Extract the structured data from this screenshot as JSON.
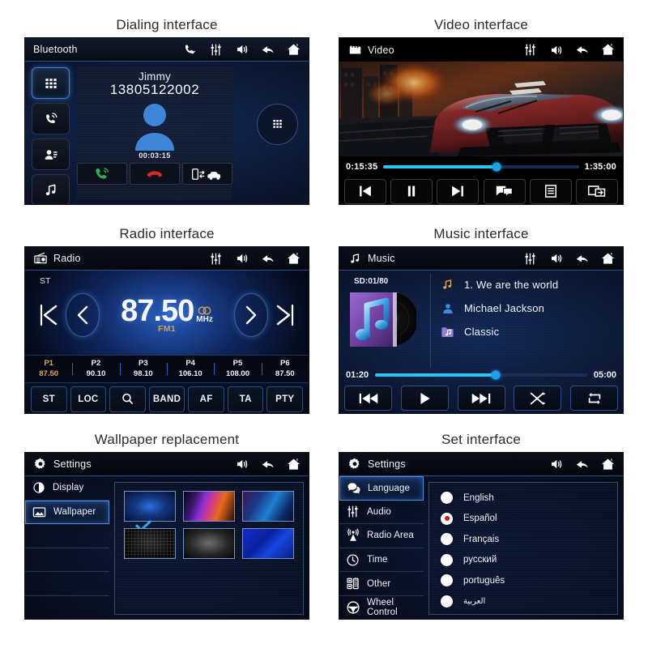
{
  "panels": {
    "dialing": {
      "caption": "Dialing interface",
      "title": "Bluetooth",
      "titlebar_icons": [
        "phone-icon",
        "equalizer-icon",
        "volume-icon",
        "back-icon",
        "home-icon"
      ],
      "side_buttons": [
        "keypad-icon",
        "call-history-icon",
        "contacts-icon",
        "music-icon"
      ],
      "contact_name": "Jimmy",
      "phone_number": "13805122002",
      "call_duration": "00:03:15",
      "actions": [
        "answer-call-icon",
        "end-call-icon",
        "transfer-audio-icon"
      ],
      "keypad_round": "keypad-icon"
    },
    "video": {
      "caption": "Video interface",
      "title": "Video",
      "title_icon": "video-clapper-icon",
      "titlebar_icons": [
        "equalizer-icon",
        "volume-icon",
        "back-icon",
        "home-icon"
      ],
      "elapsed": "0:15:35",
      "total": "1:35:00",
      "progress_percent": 58,
      "controls": [
        "previous-icon",
        "pause-icon",
        "next-icon",
        "subtitle-icon",
        "playlist-icon",
        "screen-share-icon"
      ]
    },
    "radio": {
      "caption": "Radio interface",
      "title": "Radio",
      "title_icon": "radio-icon",
      "titlebar_icons": [
        "equalizer-icon",
        "volume-icon",
        "back-icon",
        "home-icon"
      ],
      "stereo_label": "ST",
      "frequency": "87.50",
      "unit": "MHz",
      "band": "FM1",
      "tuner_buttons": [
        "seek-prev-icon",
        "step-prev-icon",
        "step-next-icon",
        "seek-next-icon"
      ],
      "presets": [
        {
          "name": "P1",
          "value": "87.50",
          "active": true
        },
        {
          "name": "P2",
          "value": "90.10",
          "active": false
        },
        {
          "name": "P3",
          "value": "98.10",
          "active": false
        },
        {
          "name": "P4",
          "value": "106.10",
          "active": false
        },
        {
          "name": "P5",
          "value": "108.00",
          "active": false
        },
        {
          "name": "P6",
          "value": "87.50",
          "active": false
        }
      ],
      "buttons": [
        "ST",
        "LOC",
        "",
        "BAND",
        "AF",
        "TA",
        "PTY"
      ],
      "search_button_index": 2
    },
    "music": {
      "caption": "Music interface",
      "title": "Music",
      "title_icon": "music-note-icon",
      "titlebar_icons": [
        "equalizer-icon",
        "volume-icon",
        "back-icon",
        "home-icon"
      ],
      "source": "SD:01/80",
      "track": "1.  We are the world",
      "artist": "Michael Jackson",
      "album": "Classic",
      "elapsed": "01:20",
      "total": "05:00",
      "progress_percent": 57,
      "controls": [
        "previous-track-icon",
        "play-icon",
        "next-track-icon",
        "shuffle-icon",
        "repeat-icon"
      ]
    },
    "wallpaper": {
      "caption": "Wallpaper replacement",
      "title": "Settings",
      "title_icon": "gear-icon",
      "titlebar_icons": [
        "volume-icon",
        "back-icon",
        "home-icon"
      ],
      "sidebar": [
        {
          "label": "Display",
          "icon": "contrast-icon",
          "selected": false
        },
        {
          "label": "Wallpaper",
          "icon": "image-icon",
          "selected": true
        },
        {
          "label": "",
          "icon": "",
          "selected": false
        },
        {
          "label": "",
          "icon": "",
          "selected": false
        },
        {
          "label": "",
          "icon": "",
          "selected": false
        },
        {
          "label": "",
          "icon": "",
          "selected": false
        }
      ],
      "thumbnails": [
        {
          "id": "wallpaper-blue-glow",
          "selected": true
        },
        {
          "id": "wallpaper-neon-wave",
          "selected": false
        },
        {
          "id": "wallpaper-cyan-bloom",
          "selected": false
        },
        {
          "id": "wallpaper-dark-grid",
          "selected": false
        },
        {
          "id": "wallpaper-grey-fade",
          "selected": false
        },
        {
          "id": "wallpaper-blue-swoosh",
          "selected": false
        }
      ],
      "check_icon": "check-icon"
    },
    "settings": {
      "caption": "Set interface",
      "title": "Settings",
      "title_icon": "gear-icon",
      "titlebar_icons": [
        "volume-icon",
        "back-icon",
        "home-icon"
      ],
      "sidebar": [
        {
          "label": "Language",
          "icon": "speech-bubble-icon",
          "selected": true
        },
        {
          "label": "Audio",
          "icon": "equalizer-icon",
          "selected": false
        },
        {
          "label": "Radio Area",
          "icon": "antenna-icon",
          "selected": false
        },
        {
          "label": "Time",
          "icon": "clock-icon",
          "selected": false
        },
        {
          "label": "Other",
          "icon": "apps-icon",
          "selected": false
        },
        {
          "label": "Wheel Control",
          "icon": "steering-wheel-icon",
          "selected": false
        }
      ],
      "languages": [
        {
          "label": "English",
          "selected": false
        },
        {
          "label": "Español",
          "selected": true
        },
        {
          "label": "Français",
          "selected": false
        },
        {
          "label": "русский",
          "selected": false
        },
        {
          "label": "português",
          "selected": false
        },
        {
          "label": "العربية",
          "selected": false
        }
      ]
    }
  },
  "colors": {
    "accent_blue": "#2aa7ef",
    "highlight_amber": "#e0a74f",
    "selected_red": "#cf1717",
    "progress_cyan": "#24c6f5",
    "answer_green": "#2fb14a",
    "end_red": "#d42a24"
  }
}
